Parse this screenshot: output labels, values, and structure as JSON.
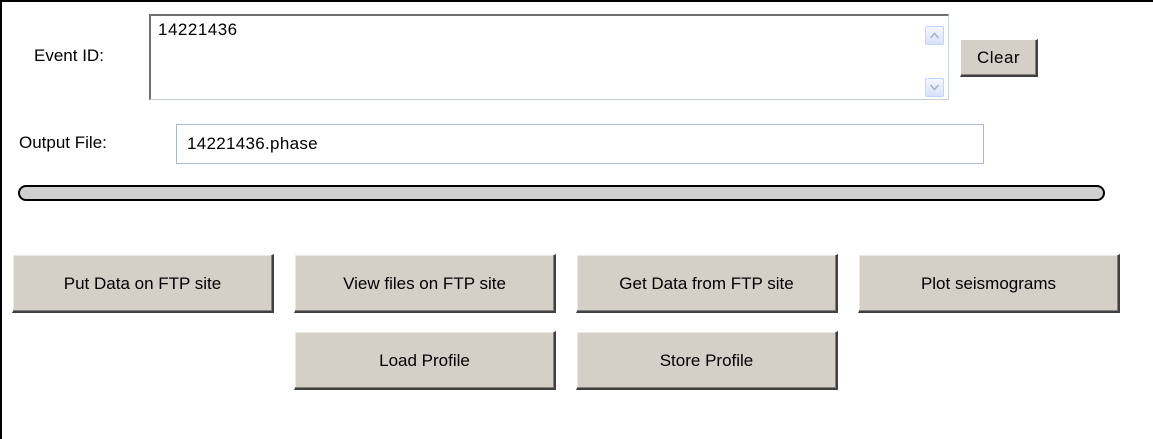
{
  "event_id": {
    "label": "Event ID:",
    "value": "14221436",
    "scroll_up_icon": "arrow-up-icon",
    "scroll_down_icon": "arrow-down-icon"
  },
  "clear_label": "Clear",
  "output_file": {
    "label": "Output File:",
    "value": "14221436.phase"
  },
  "progress": {
    "value": 0
  },
  "buttons": {
    "put_data": "Put Data on FTP site",
    "view_files": "View files on FTP site",
    "get_data": "Get Data from FTP site",
    "plot": "Plot seismograms",
    "load_profile": "Load Profile",
    "store_profile": "Store Profile"
  },
  "colors": {
    "button_face": "#d4d0c8",
    "field_border": "#a9b8c8",
    "background": "#ffffff"
  }
}
